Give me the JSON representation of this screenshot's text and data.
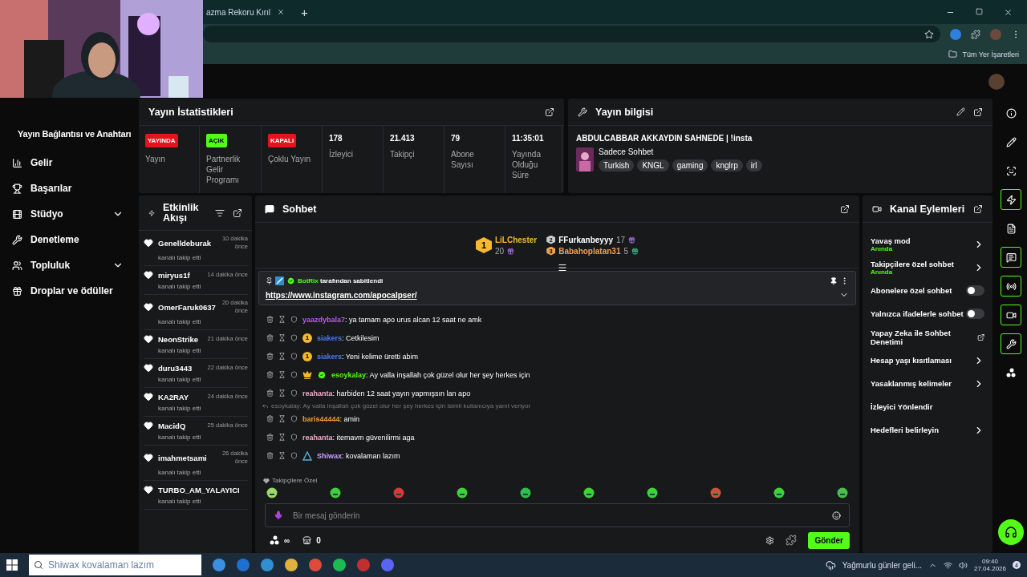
{
  "browser": {
    "tab_title": "azma Rekoru Kırıl",
    "new_tab": "+",
    "bookmark": "Tüm Yer İşaretleri"
  },
  "sidebar": {
    "heading": "Yayın Bağlantısı ve Anahtarı",
    "items": [
      {
        "kind": "chart",
        "label": "Gelir",
        "expandable": false
      },
      {
        "kind": "trophy",
        "label": "Başarılar",
        "expandable": false
      },
      {
        "kind": "film",
        "label": "Stüdyo",
        "expandable": true
      },
      {
        "kind": "wrench",
        "label": "Denetleme",
        "expandable": false
      },
      {
        "kind": "users",
        "label": "Topluluk",
        "expandable": true
      },
      {
        "kind": "gift",
        "label": "Droplar ve ödüller",
        "expandable": false
      }
    ]
  },
  "stats": {
    "title": "Yayın İstatistikleri",
    "statuses": [
      {
        "badge": "YAYINDA",
        "label": "Yayın",
        "color": "#e5131d"
      },
      {
        "badge": "AÇIK",
        "label": "Partnerlik Gelir Programı",
        "color": "#53fc18"
      },
      {
        "badge": "KAPALI",
        "label": "Çoklu Yayın",
        "color": "#e5131d"
      }
    ],
    "metrics": [
      {
        "value": "178",
        "label": "İzleyici"
      },
      {
        "value": "21.413",
        "label": "Takipçi"
      },
      {
        "value": "79",
        "label": "Abone Sayısı"
      },
      {
        "value": "11:35:01",
        "label": "Yayında Olduğu Süre"
      }
    ]
  },
  "info": {
    "title": "Yayın bilgisi",
    "stream_title": "ABDULCABBAR AKKAYDIN SAHNEDE | !insta",
    "category": "Sadece Sohbet",
    "tags": [
      "Turkish",
      "KNGL",
      "gaming",
      "knglrp",
      "irl"
    ]
  },
  "events": {
    "title": "Etkinlik Akışı",
    "items": [
      {
        "user": "Genelldeburak",
        "time": "10 dakika önce",
        "action": "kanalı takip etti"
      },
      {
        "user": "miryus1f",
        "time": "14 dakika önce",
        "action": "kanalı takip etti"
      },
      {
        "user": "OmerFaruk0637",
        "time": "20 dakika önce",
        "action": "kanalı takip etti"
      },
      {
        "user": "NeonStrike",
        "time": "21 dakika önce",
        "action": "kanalı takip etti"
      },
      {
        "user": "duru3443",
        "time": "22 dakika önce",
        "action": "kanalı takip etti"
      },
      {
        "user": "KA2RAY",
        "time": "24 dakika önce",
        "action": "kanalı takip etti"
      },
      {
        "user": "MacidQ",
        "time": "25 dakika önce",
        "action": "kanalı takip etti"
      },
      {
        "user": "imahmetsami",
        "time": "26 dakika önce",
        "action": "kanalı takip etti"
      },
      {
        "user": "TURBO_AM_YALAYICI",
        "action": "kanalı takip etti"
      }
    ]
  },
  "chat": {
    "title": "Sohbet",
    "leaderboard": [
      {
        "rank": "1",
        "name": "LiLChester",
        "count": "20",
        "color": "#f5b82e"
      },
      {
        "rank": "2",
        "name": "FFurkanbeyyy",
        "count": "17",
        "color": "#ffffff"
      },
      {
        "rank": "3",
        "name": "Babahoplatan31",
        "count": "5",
        "color": "#f0a050"
      }
    ],
    "pinned": {
      "by": "BotRix",
      "suffix": " tarafından sabitlendi",
      "link": "https://www.instagram.com/apocalpser/"
    },
    "messages": [
      {
        "user": "yaazdybala7",
        "color": "#b45cf0",
        "text": ": ya tamam apo urus alcan 12 saat ne amk"
      },
      {
        "user": "siakers",
        "color": "#4a7ef0",
        "badges": [
          {
            "kind": "sub",
            "text": "1"
          }
        ],
        "text": ": Cetkilesim"
      },
      {
        "user": "siakers",
        "color": "#4a7ef0",
        "badges": [
          {
            "kind": "sub",
            "text": "1"
          }
        ],
        "text": ": Yeni kelime üretti abim"
      },
      {
        "user": "esoykalay",
        "color": "#53fc18",
        "badges": [
          {
            "kind": "crown"
          },
          {
            "kind": "verified"
          }
        ],
        "text": ": Ay valla inşallah çok güzel olur her şey herkes için"
      },
      {
        "user": "reahanta",
        "color": "#f5a8c8",
        "text": ": harbiden 12 saat yayın yapmışsın lan apo"
      },
      {
        "user": "baris44444",
        "color": "#f0a030",
        "reply": "esoykalay: Ay valla inşallah çok güzel olur her şey herkes için isimli kullanıcıya yanıt veriyor",
        "text": ": amin"
      },
      {
        "user": "reahanta",
        "color": "#f5a8c8",
        "text": ": itemavm güvenilirmi aga"
      },
      {
        "user": "Shiwax",
        "color": "#c8a0ff",
        "badges": [
          {
            "kind": "og"
          }
        ],
        "text": ": kovalaman lazım"
      }
    ],
    "emote_section": "Takipçilere Özel",
    "emotes": [
      {
        "color": "#9fd86a"
      },
      {
        "color": "#3dd13a"
      },
      {
        "color": "#d9363e"
      },
      {
        "color": "#3dd13a"
      },
      {
        "color": "#2fbf4a"
      },
      {
        "color": "#3dd13a"
      },
      {
        "color": "#3dd13a"
      },
      {
        "color": "#c8553a"
      },
      {
        "color": "#3dd13a"
      },
      {
        "color": "#46c04a"
      }
    ],
    "input": {
      "placeholder": "Bir mesaj gönderin"
    },
    "points": "∞",
    "store_count": "0",
    "send": "Gönder"
  },
  "actions": {
    "title": "Kanal Eylemleri",
    "items": [
      {
        "kind": "link",
        "label": "Yavaş mod",
        "sub": "Anında"
      },
      {
        "kind": "link",
        "label": "Takipçilere özel sohbet",
        "sub": "Anında"
      },
      {
        "kind": "toggle",
        "label": "Abonelere özel sohbet",
        "on": false
      },
      {
        "kind": "toggle",
        "label": "Yalnızca ifadelerle sohbet",
        "on": false
      },
      {
        "kind": "external",
        "label": "Yapay Zeka ile Sohbet Denetimi"
      },
      {
        "kind": "link",
        "label": "Hesap yaşı kısıtlaması"
      },
      {
        "kind": "link",
        "label": "Yasaklanmış kelimeler"
      },
      {
        "kind": "plain",
        "label": "İzleyici Yönlendir"
      },
      {
        "kind": "link",
        "label": "Hedefleri belirleyin"
      }
    ]
  },
  "rail": [
    {
      "kind": "info",
      "active": false
    },
    {
      "kind": "pencil",
      "active": false
    },
    {
      "kind": "scan",
      "active": false
    },
    {
      "kind": "zap",
      "active": true
    },
    {
      "kind": "doc",
      "active": false
    },
    {
      "kind": "chat",
      "active": true
    },
    {
      "kind": "radio",
      "active": true
    },
    {
      "kind": "video",
      "active": true
    },
    {
      "kind": "wrench",
      "active": true
    },
    {
      "kind": "dots",
      "active": false
    }
  ],
  "taskbar": {
    "search": "Shiwax kovalaman lazım",
    "weather": "Yağmurlu günler geli...",
    "time": "09:40",
    "date": "27.04.2026",
    "notifications": "4"
  }
}
